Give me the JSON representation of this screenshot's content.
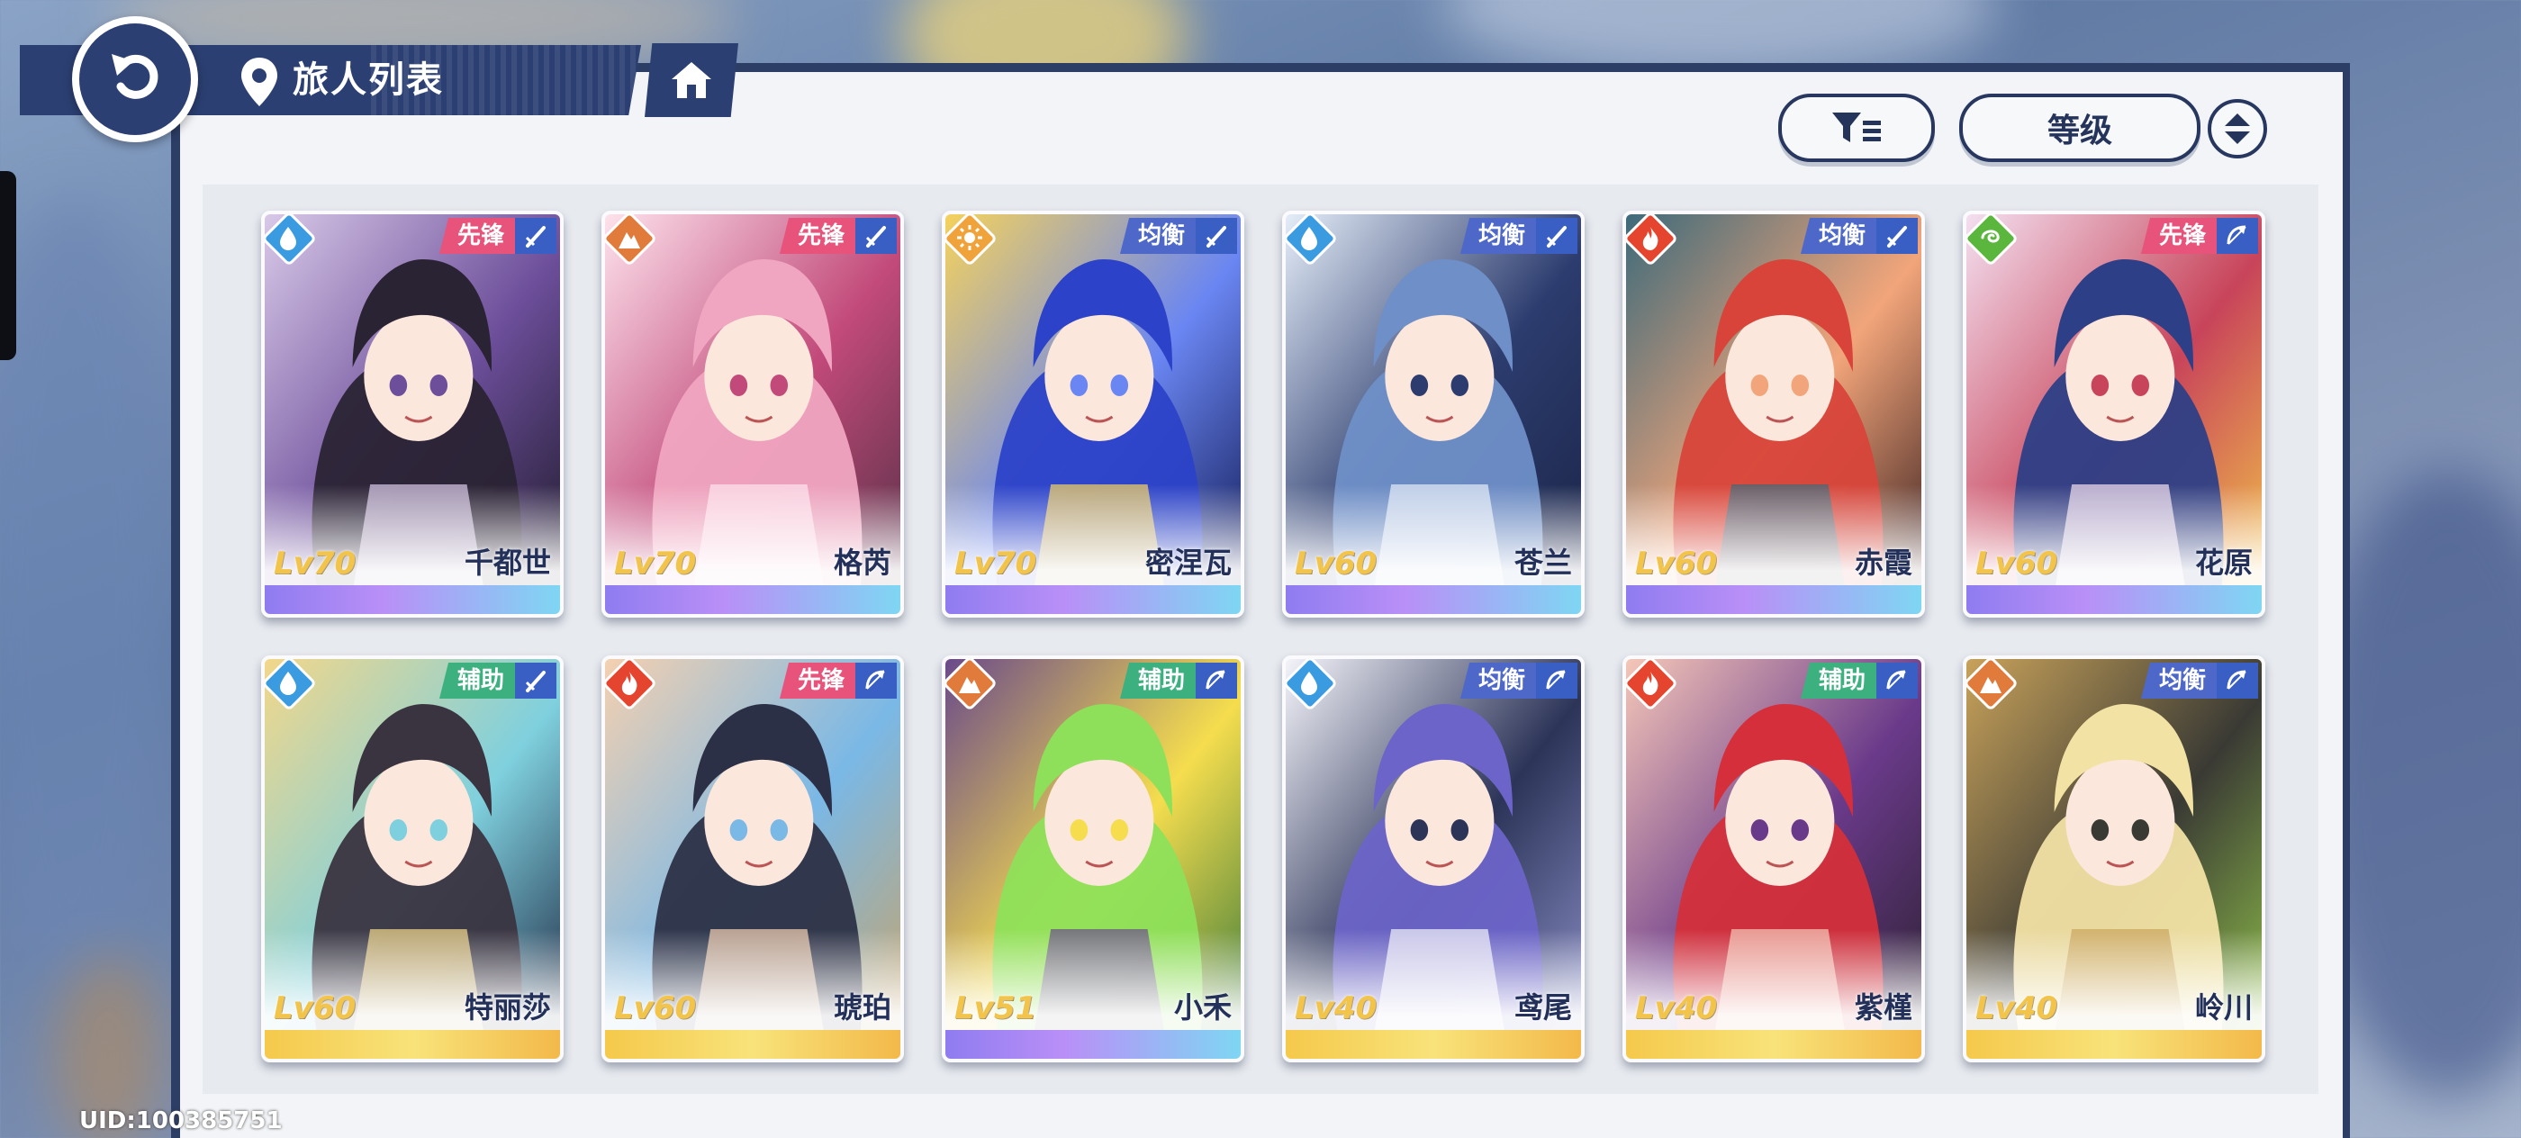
{
  "header": {
    "title": "旅人列表"
  },
  "toolbar": {
    "sort_label": "等级"
  },
  "footer": {
    "uid": "UID:100385751"
  },
  "colors": {
    "header_navy": "#2b3f72",
    "panel_bg": "#f2f4f7",
    "role_vanguard": "#e8537b",
    "role_balance": "#4d68c9",
    "role_support": "#3db07f",
    "elem_water": "#3a9be0",
    "elem_rock": "#e07b3c",
    "elem_light": "#f0a33a",
    "elem_fire": "#e5452f",
    "elem_wind": "#5ab63c"
  },
  "characters": [
    {
      "name": "千都世",
      "level": "Lv70",
      "role": "先锋",
      "element": "water-drop-icon",
      "weapon": "sword-icon",
      "strip": "purple"
    },
    {
      "name": "格芮",
      "level": "Lv70",
      "role": "先锋",
      "element": "rock-icon",
      "weapon": "sword-icon",
      "strip": "purple"
    },
    {
      "name": "密涅瓦",
      "level": "Lv70",
      "role": "均衡",
      "element": "sun-icon",
      "weapon": "sword-icon",
      "strip": "purple"
    },
    {
      "name": "苍兰",
      "level": "Lv60",
      "role": "均衡",
      "element": "water-drop-icon",
      "weapon": "sword-icon",
      "strip": "purple"
    },
    {
      "name": "赤霞",
      "level": "Lv60",
      "role": "均衡",
      "element": "flame-icon",
      "weapon": "sword-icon",
      "strip": "purple"
    },
    {
      "name": "花原",
      "level": "Lv60",
      "role": "先锋",
      "element": "wind-icon",
      "weapon": "bow-icon",
      "strip": "purple"
    },
    {
      "name": "特丽莎",
      "level": "Lv60",
      "role": "辅助",
      "element": "water-drop-icon",
      "weapon": "sword-icon",
      "strip": "gold"
    },
    {
      "name": "琥珀",
      "level": "Lv60",
      "role": "先锋",
      "element": "flame-icon",
      "weapon": "bow-icon",
      "strip": "gold"
    },
    {
      "name": "小禾",
      "level": "Lv51",
      "role": "辅助",
      "element": "rock-icon",
      "weapon": "bow-icon",
      "strip": "purple"
    },
    {
      "name": "鸢尾",
      "level": "Lv40",
      "role": "均衡",
      "element": "water-drop-icon",
      "weapon": "bow-icon",
      "strip": "gold"
    },
    {
      "name": "紫槿",
      "level": "Lv40",
      "role": "辅助",
      "element": "flame-icon",
      "weapon": "bow-icon",
      "strip": "gold"
    },
    {
      "name": "岭川",
      "level": "Lv40",
      "role": "均衡",
      "element": "rock-icon",
      "weapon": "bow-icon",
      "strip": "gold"
    }
  ]
}
